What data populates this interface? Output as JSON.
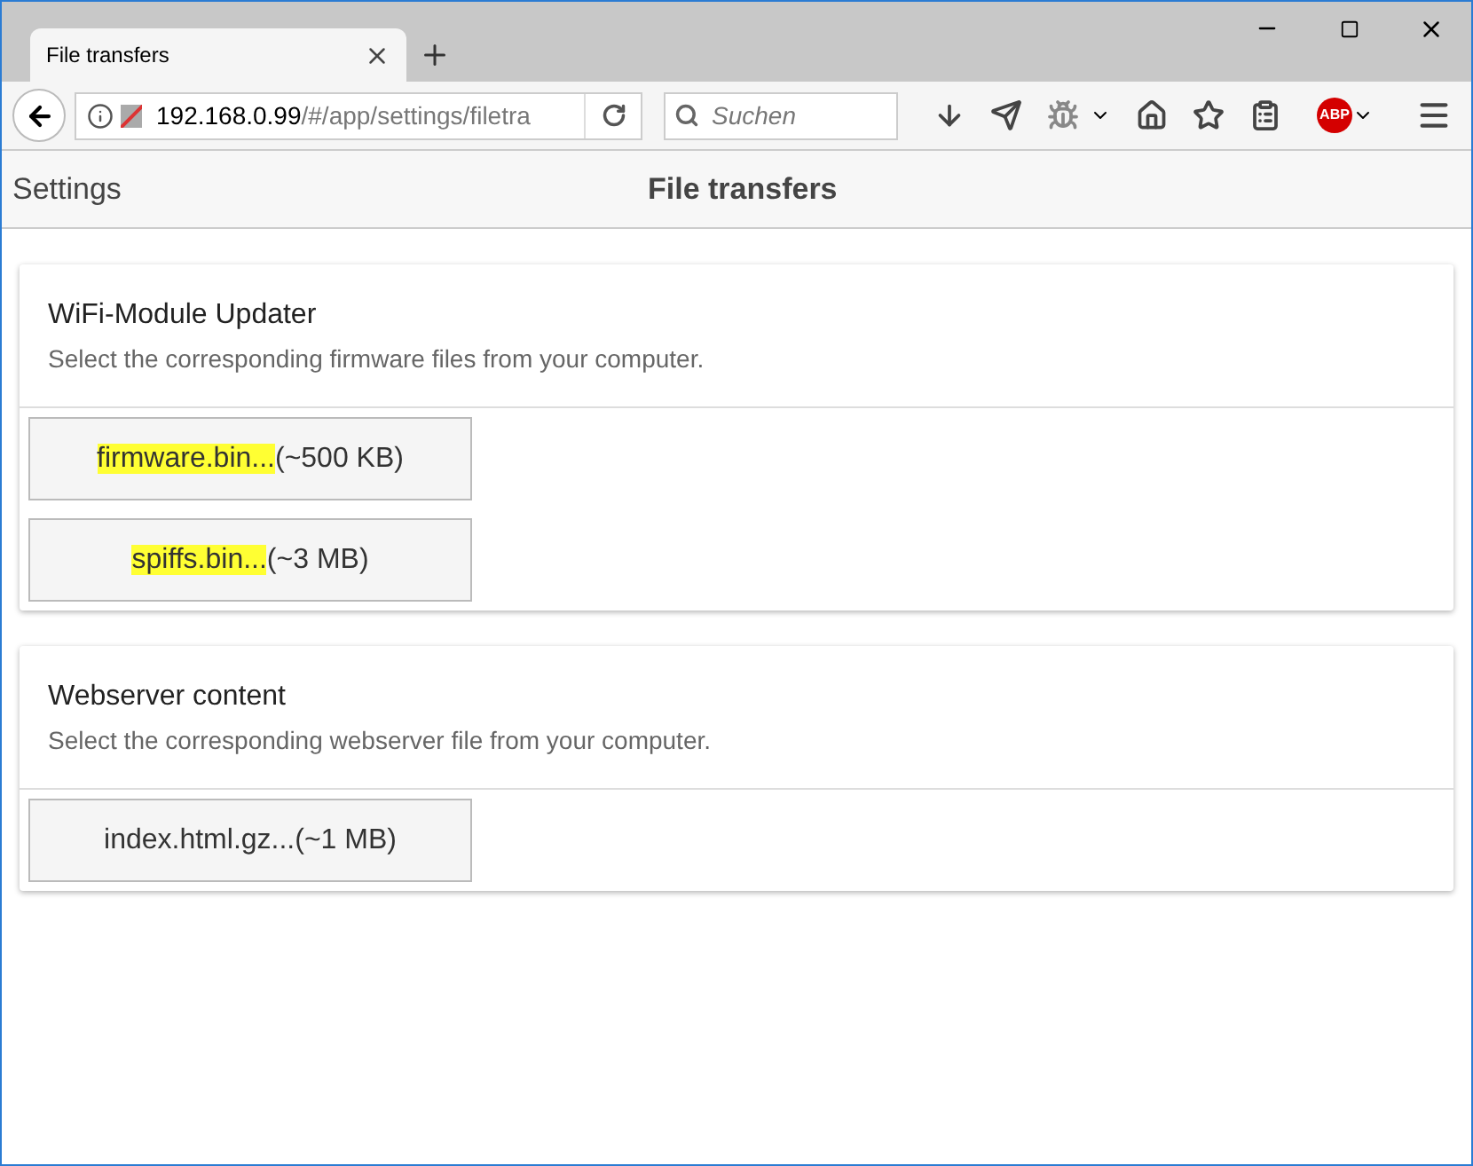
{
  "browser": {
    "tab": {
      "title": "File transfers",
      "selected": true
    },
    "url": {
      "host": "192.168.0.99",
      "path": "/#/app/settings/filetra"
    },
    "search": {
      "placeholder": "Suchen"
    },
    "adblock_badge": "ABP"
  },
  "app_bar": {
    "back_label": "Settings",
    "title": "File transfers"
  },
  "cards": [
    {
      "title": "WiFi-Module Updater",
      "subtitle": "Select the corresponding firmware files from your computer.",
      "buttons": [
        {
          "highlighted": "firmware.bin...",
          "text": "(~500 KB)"
        },
        {
          "highlighted": "spiffs.bin...",
          "text": "(~3 MB)"
        }
      ]
    },
    {
      "title": "Webserver content",
      "subtitle": "Select the corresponding webserver file from your computer.",
      "buttons": [
        {
          "text": "index.html.gz...(~1 MB)"
        }
      ]
    }
  ]
}
